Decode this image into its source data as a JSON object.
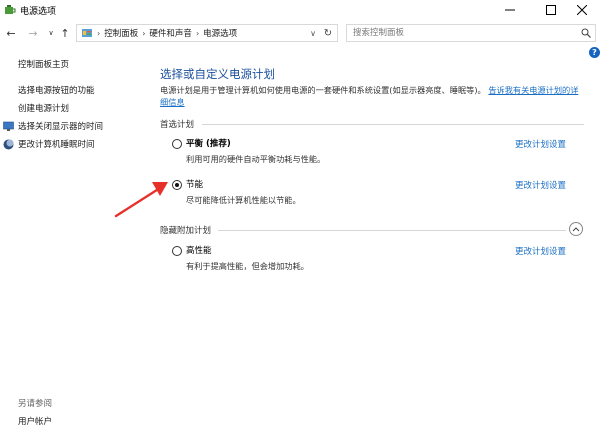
{
  "window": {
    "title": "电源选项",
    "controls": {
      "minimize": "minimize-icon",
      "maximize": "maximize-icon",
      "close": "close-icon"
    }
  },
  "nav": {
    "back": "back-arrow-icon",
    "forward": "forward-arrow-icon",
    "recent": "chevron-down-icon",
    "up": "up-arrow-icon",
    "breadcrumbs": [
      "控制面板",
      "硬件和声音",
      "电源选项"
    ],
    "search_placeholder": "搜索控制面板"
  },
  "sidebar": {
    "home": "控制面板主页",
    "items": [
      {
        "label": "选择电源按钮的功能"
      },
      {
        "label": "创建电源计划"
      },
      {
        "label": "选择关闭显示器的时间",
        "icon": "monitor-icon"
      },
      {
        "label": "更改计算机睡眠时间",
        "icon": "moon-icon"
      }
    ],
    "see_also_title": "另请参阅",
    "see_also_items": [
      {
        "label": "用户帐户"
      }
    ]
  },
  "main": {
    "title": "选择或自定义电源计划",
    "description": "电源计划是用于管理计算机如何使用电源的一套硬件和系统设置(如显示器亮度、睡眠等)。",
    "description_link": "告诉我有关电源计划的详细信息",
    "preferred_label": "首选计划",
    "hidden_label": "隐藏附加计划",
    "change_label": "更改计划设置",
    "plans": [
      {
        "name": "平衡 (推荐)",
        "desc": "利用可用的硬件自动平衡功耗与性能。",
        "selected": false
      },
      {
        "name": "节能",
        "desc": "尽可能降低计算机性能以节能。",
        "selected": true
      }
    ],
    "hidden_plans": [
      {
        "name": "高性能",
        "desc": "有利于提高性能，但会增加功耗。",
        "selected": false
      }
    ]
  },
  "colors": {
    "title_blue": "#1a4f9c",
    "link_blue": "#1a6fc4",
    "annotation_red": "#e8302a",
    "help_blue": "#1565c0"
  }
}
